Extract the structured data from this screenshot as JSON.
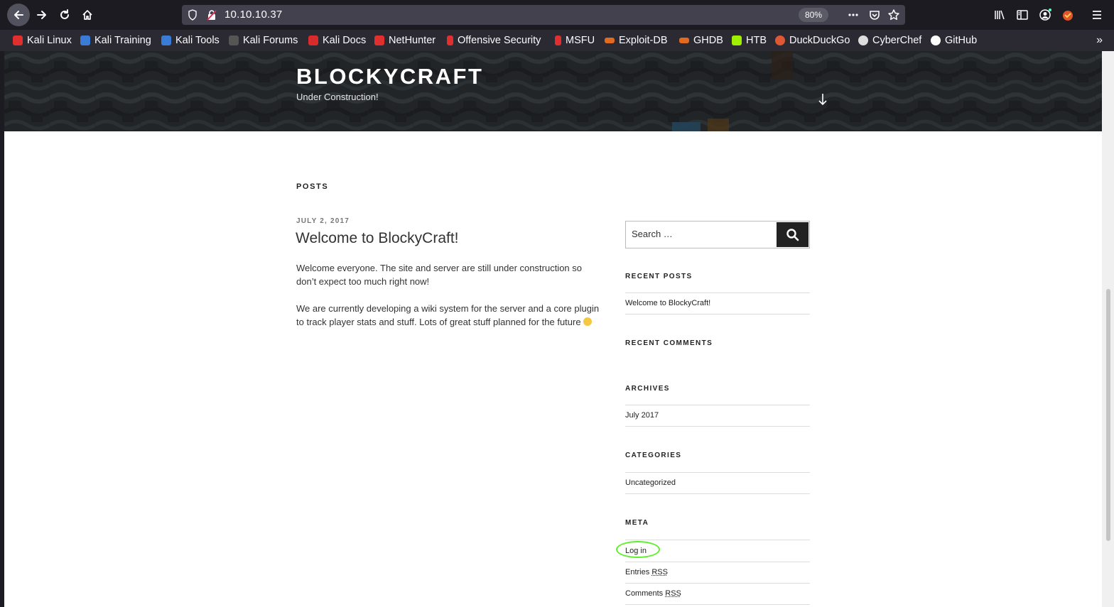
{
  "browser": {
    "url": "10.10.10.37",
    "zoom": "80%",
    "bookmarks": [
      {
        "label": "Kali Linux",
        "icon": "kali-dragon-icon",
        "color": "#e02f2f"
      },
      {
        "label": "Kali Training",
        "icon": "kali-training-icon",
        "color": "#3a7bd5"
      },
      {
        "label": "Kali Tools",
        "icon": "kali-tools-icon",
        "color": "#3a7bd5"
      },
      {
        "label": "Kali Forums",
        "icon": "kali-forums-icon",
        "color": "#888888"
      },
      {
        "label": "Kali Docs",
        "icon": "kali-docs-icon",
        "color": "#d92b2b"
      },
      {
        "label": "NetHunter",
        "icon": "nethunter-icon",
        "color": "#e02f2f"
      },
      {
        "label": "Offensive Security",
        "icon": "offsec-icon",
        "color": "#e02f2f"
      },
      {
        "label": "MSFU",
        "icon": "msfu-icon",
        "color": "#e02f2f"
      },
      {
        "label": "Exploit-DB",
        "icon": "exploit-db-icon",
        "color": "#e06a1f"
      },
      {
        "label": "GHDB",
        "icon": "ghdb-icon",
        "color": "#e06a1f"
      },
      {
        "label": "HTB",
        "icon": "htb-icon",
        "color": "#9fef00"
      },
      {
        "label": "DuckDuckGo",
        "icon": "duckduckgo-icon",
        "color": "#de5833"
      },
      {
        "label": "CyberChef",
        "icon": "cyberchef-icon",
        "color": "#dddddd"
      },
      {
        "label": "GitHub",
        "icon": "github-icon",
        "color": "#ffffff"
      }
    ]
  },
  "site": {
    "title": "BLOCKYCRAFT",
    "description": "Under Construction!"
  },
  "posts": {
    "heading": "POSTS",
    "date": "JULY 2, 2017",
    "title": "Welcome to BlockyCraft!",
    "p1": "Welcome everyone. The site and server are still under construction so don’t expect too much right now!",
    "p2": "We are currently developing a wiki system for the server and a core plugin to track player stats and stuff. Lots of great stuff planned for the future"
  },
  "sidebar": {
    "search_placeholder": "Search …",
    "recent_posts_title": "RECENT POSTS",
    "recent_posts": [
      "Welcome to BlockyCraft!"
    ],
    "recent_comments_title": "RECENT COMMENTS",
    "archives_title": "ARCHIVES",
    "archives": [
      "July 2017"
    ],
    "categories_title": "CATEGORIES",
    "categories": [
      "Uncategorized"
    ],
    "meta_title": "META",
    "meta_login": "Log in",
    "meta_entries": "Entries",
    "meta_comments": "Comments",
    "rss": "RSS"
  }
}
